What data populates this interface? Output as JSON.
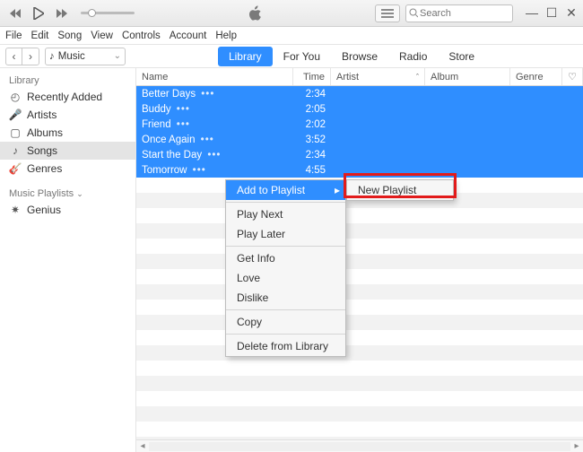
{
  "titlebar": {
    "search_placeholder": "Search"
  },
  "menubar": [
    "File",
    "Edit",
    "Song",
    "View",
    "Controls",
    "Account",
    "Help"
  ],
  "source_selector": {
    "label": "Music"
  },
  "tabs": [
    {
      "label": "Library",
      "active": true
    },
    {
      "label": "For You",
      "active": false
    },
    {
      "label": "Browse",
      "active": false
    },
    {
      "label": "Radio",
      "active": false
    },
    {
      "label": "Store",
      "active": false
    }
  ],
  "sidebar": {
    "library_header": "Library",
    "items": [
      {
        "label": "Recently Added",
        "icon": "clock-icon"
      },
      {
        "label": "Artists",
        "icon": "mic-icon"
      },
      {
        "label": "Albums",
        "icon": "album-icon"
      },
      {
        "label": "Songs",
        "icon": "note-icon",
        "selected": true
      },
      {
        "label": "Genres",
        "icon": "genre-icon"
      }
    ],
    "playlists_header": "Music Playlists",
    "playlists": [
      {
        "label": "Genius",
        "icon": "genius-icon"
      }
    ]
  },
  "columns": {
    "name": "Name",
    "time": "Time",
    "artist": "Artist",
    "album": "Album",
    "genre": "Genre"
  },
  "songs": [
    {
      "name": "Better Days",
      "time": "2:34"
    },
    {
      "name": "Buddy",
      "time": "2:05"
    },
    {
      "name": "Friend",
      "time": "2:02"
    },
    {
      "name": "Once Again",
      "time": "3:52"
    },
    {
      "name": "Start the Day",
      "time": "2:34"
    },
    {
      "name": "Tomorrow",
      "time": "4:55"
    }
  ],
  "context_menu": {
    "items": [
      {
        "label": "Add to Playlist",
        "highlight": true,
        "submenu": true
      },
      {
        "sep": true
      },
      {
        "label": "Play Next"
      },
      {
        "label": "Play Later"
      },
      {
        "sep": true
      },
      {
        "label": "Get Info"
      },
      {
        "label": "Love"
      },
      {
        "label": "Dislike"
      },
      {
        "sep": true
      },
      {
        "label": "Copy"
      },
      {
        "sep": true
      },
      {
        "label": "Delete from Library"
      }
    ],
    "submenu_item": {
      "label": "New Playlist"
    }
  }
}
